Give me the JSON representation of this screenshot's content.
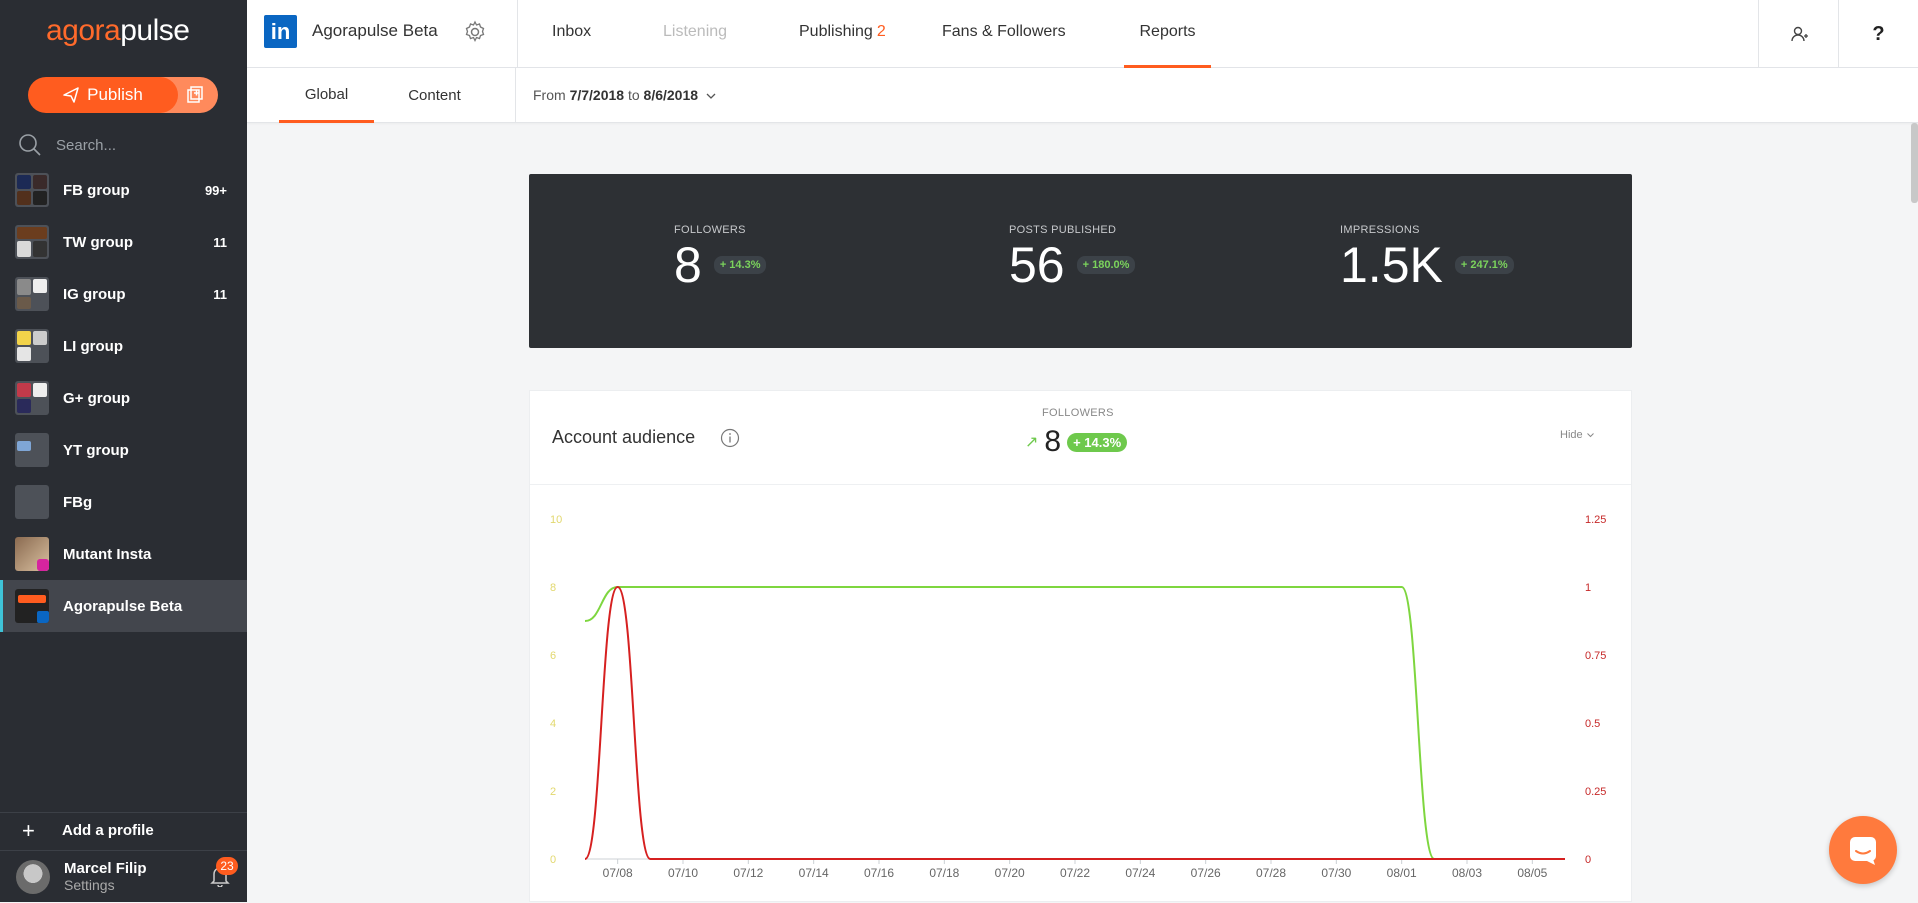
{
  "brand": {
    "agora": "agora",
    "pulse": "pulse",
    "accent": "#ff5c1f"
  },
  "sidebar": {
    "publish_label": "Publish",
    "search_placeholder": "Search...",
    "profiles": [
      {
        "name": "FB group",
        "count": "99+"
      },
      {
        "name": "TW group",
        "count": "11"
      },
      {
        "name": "IG group",
        "count": "11"
      },
      {
        "name": "LI group",
        "count": ""
      },
      {
        "name": "G+ group",
        "count": ""
      },
      {
        "name": "YT group",
        "count": ""
      },
      {
        "name": "FBg",
        "count": ""
      },
      {
        "name": "Mutant Insta",
        "count": ""
      },
      {
        "name": "Agorapulse Beta",
        "count": ""
      }
    ],
    "add_profile": "Add a profile",
    "user": {
      "name": "Marcel Filip",
      "sub": "Settings",
      "notifications": "23"
    }
  },
  "topbar": {
    "account_name": "Agorapulse Beta",
    "li_logo": "in",
    "nav": [
      {
        "label": "Inbox"
      },
      {
        "label": "Listening"
      },
      {
        "label": "Publishing",
        "badge": "2"
      },
      {
        "label": "Fans & Followers"
      },
      {
        "label": "Reports"
      }
    ],
    "help": "?"
  },
  "subbar": {
    "tabs": [
      {
        "label": "Global"
      },
      {
        "label": "Content"
      }
    ],
    "range_from_label": "From",
    "range_from": "7/7/2018",
    "range_to_label": "to",
    "range_to": "8/6/2018"
  },
  "stats": [
    {
      "label": "FOLLOWERS",
      "value": "8",
      "delta": "+ 14.3%"
    },
    {
      "label": "POSTS PUBLISHED",
      "value": "56",
      "delta": "+ 180.0%"
    },
    {
      "label": "IMPRESSIONS",
      "value": "1.5K",
      "delta": "+ 247.1%"
    }
  ],
  "audience": {
    "title": "Account audience",
    "kpi_label": "FOLLOWERS",
    "kpi_value": "8",
    "kpi_delta": "+ 14.3%",
    "hide_label": "Hide"
  },
  "chart_data": {
    "type": "line",
    "x": [
      "07/07",
      "07/08",
      "07/09",
      "07/10",
      "07/11",
      "07/12",
      "07/13",
      "07/14",
      "07/15",
      "07/16",
      "07/17",
      "07/18",
      "07/19",
      "07/20",
      "07/21",
      "07/22",
      "07/23",
      "07/24",
      "07/25",
      "07/26",
      "07/27",
      "07/28",
      "07/29",
      "07/30",
      "07/31",
      "08/01",
      "08/02",
      "08/03",
      "08/04",
      "08/05",
      "08/06"
    ],
    "tick_labels": [
      "07/08",
      "07/10",
      "07/12",
      "07/14",
      "07/16",
      "07/18",
      "07/20",
      "07/22",
      "07/24",
      "07/26",
      "07/28",
      "07/30",
      "08/01",
      "08/03",
      "08/05"
    ],
    "y_left_ticks": [
      "0",
      "2",
      "4",
      "6",
      "8",
      "10"
    ],
    "y_right_ticks": [
      "0",
      "0.25",
      "0.5",
      "0.75",
      "1",
      "1.25"
    ],
    "ylim_left": [
      0,
      10
    ],
    "ylim_right": [
      0,
      1.25
    ],
    "series": [
      {
        "axis": "left",
        "color": "#7ed63f",
        "values": [
          7,
          8,
          8,
          8,
          8,
          8,
          8,
          8,
          8,
          8,
          8,
          8,
          8,
          8,
          8,
          8,
          8,
          8,
          8,
          8,
          8,
          8,
          8,
          8,
          8,
          8,
          0,
          0,
          0,
          0,
          0
        ]
      },
      {
        "axis": "right",
        "color": "#d62020",
        "values": [
          0,
          1,
          0,
          0,
          0,
          0,
          0,
          0,
          0,
          0,
          0,
          0,
          0,
          0,
          0,
          0,
          0,
          0,
          0,
          0,
          0,
          0,
          0,
          0,
          0,
          0,
          0,
          0,
          0,
          0,
          0
        ]
      }
    ],
    "grid": false,
    "left_tick_color": "#e2d86e",
    "right_tick_color": "#c62828"
  }
}
